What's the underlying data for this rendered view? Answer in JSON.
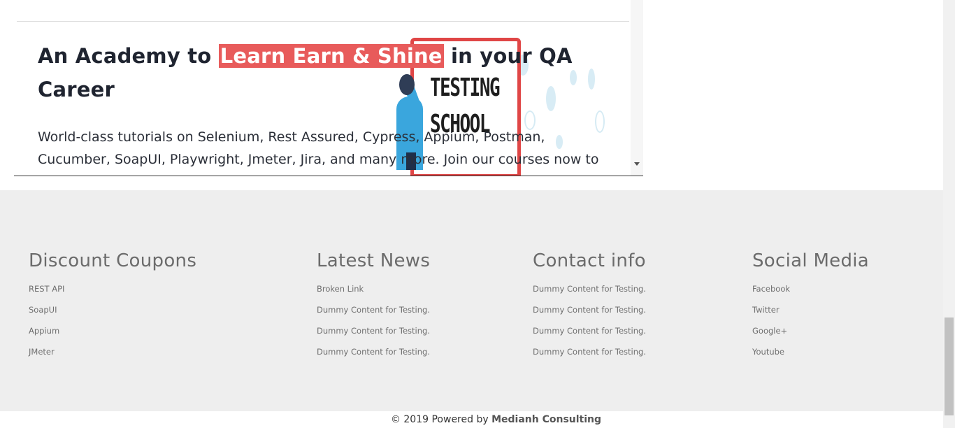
{
  "hero": {
    "heading_before": "An Academy to ",
    "heading_highlight": "Learn Earn & Shine",
    "heading_after": "  in your QA Career",
    "description": "World-class tutorials on Selenium, Rest Assured, Cypress, Appium, Postman, Cucumber, SoapUI, Playwright, Jmeter, Jira, and many more. Join our courses now to get the best job",
    "board_text_line1": "TESTING",
    "board_text_line2": "SCHOOL"
  },
  "footer": {
    "columns": [
      {
        "title": "Discount Coupons",
        "links": [
          "REST API",
          "SoapUI",
          "Appium",
          "JMeter"
        ]
      },
      {
        "title": "Latest News",
        "links": [
          "Broken Link",
          "Dummy Content for Testing.",
          "Dummy Content for Testing.",
          "Dummy Content for Testing."
        ]
      },
      {
        "title": "Contact info",
        "links": [
          "Dummy Content for Testing.",
          "Dummy Content for Testing.",
          "Dummy Content for Testing.",
          "Dummy Content for Testing."
        ]
      },
      {
        "title": "Social Media",
        "links": [
          "Facebook",
          "Twitter",
          "Google+",
          "Youtube"
        ]
      }
    ]
  },
  "copyright": {
    "prefix": "© 2019 Powered by ",
    "company": "Medianh Consulting"
  },
  "colors": {
    "highlight": "#e85b5b",
    "footer_bg": "#eeeeee",
    "board_border": "#e04646"
  }
}
